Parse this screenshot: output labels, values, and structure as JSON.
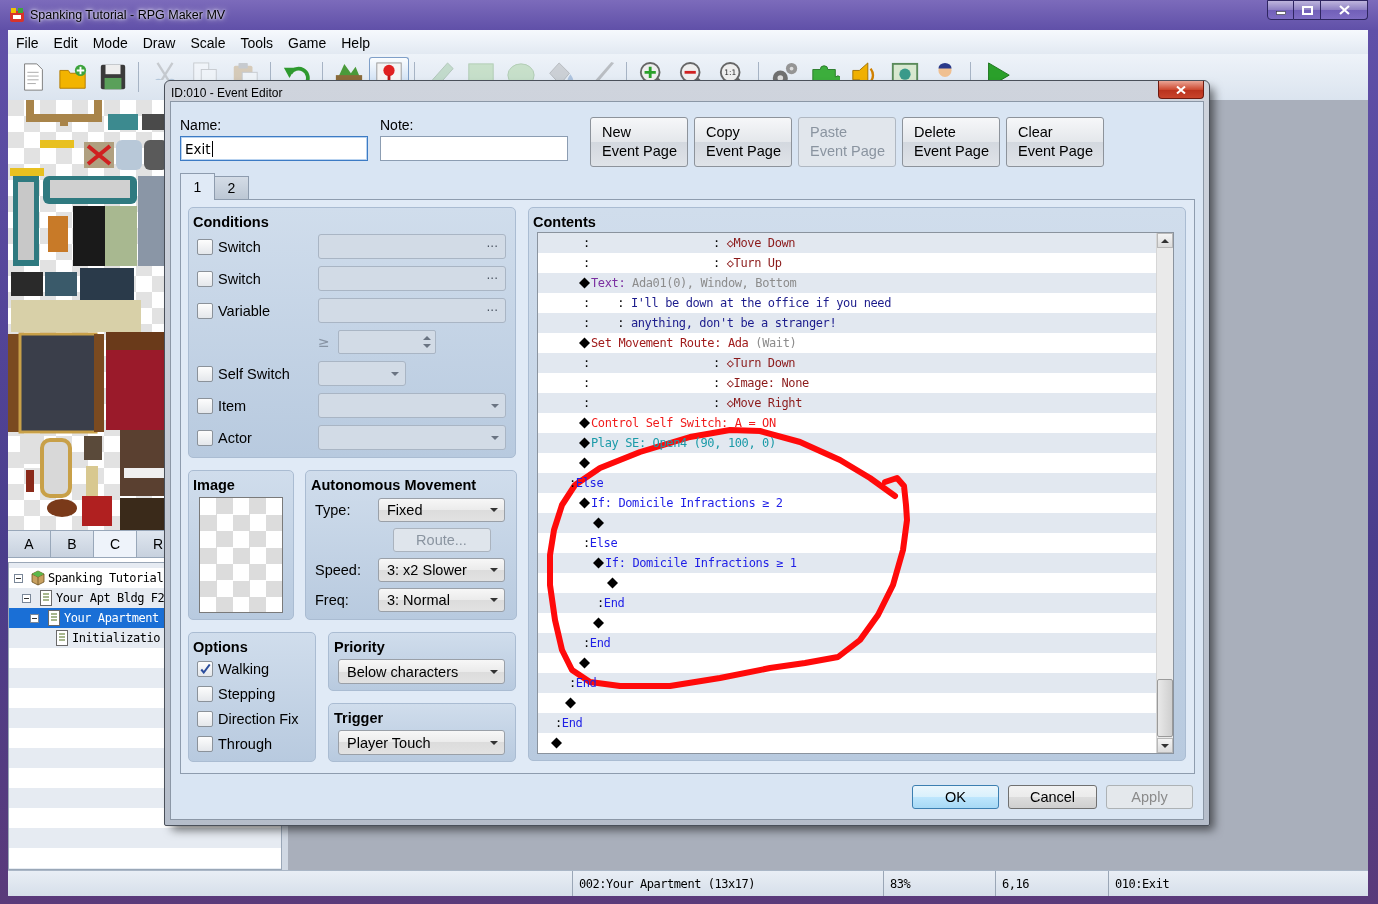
{
  "window": {
    "title": "Spanking Tutorial - RPG Maker MV"
  },
  "menu": [
    "File",
    "Edit",
    "Mode",
    "Draw",
    "Scale",
    "Tools",
    "Game",
    "Help"
  ],
  "toolbar": [
    {
      "buttons": [
        {
          "kind": "new",
          "disabled": false,
          "selected": false
        },
        {
          "kind": "open",
          "disabled": false,
          "selected": false
        },
        {
          "kind": "save",
          "disabled": false,
          "selected": false
        }
      ]
    },
    {
      "buttons": [
        {
          "kind": "cut",
          "disabled": true,
          "selected": false
        },
        {
          "kind": "copy",
          "disabled": true,
          "selected": false
        },
        {
          "kind": "paste",
          "disabled": true,
          "selected": false
        }
      ]
    },
    {
      "buttons": [
        {
          "kind": "undo",
          "disabled": false,
          "selected": false
        }
      ]
    },
    {
      "buttons": [
        {
          "kind": "map",
          "disabled": false,
          "selected": false
        },
        {
          "kind": "event",
          "disabled": false,
          "selected": true
        }
      ]
    },
    {
      "buttons": [
        {
          "kind": "pencil",
          "disabled": true,
          "selected": false
        },
        {
          "kind": "rectangle",
          "disabled": true,
          "selected": false
        },
        {
          "kind": "ellipse",
          "disabled": true,
          "selected": false
        },
        {
          "kind": "fill",
          "disabled": true,
          "selected": false
        },
        {
          "kind": "shadow",
          "disabled": true,
          "selected": false
        }
      ]
    },
    {
      "buttons": [
        {
          "kind": "zoom_in",
          "disabled": false,
          "selected": false
        },
        {
          "kind": "zoom_out",
          "disabled": false,
          "selected": false
        },
        {
          "kind": "zoom_reset",
          "label": "1:1",
          "disabled": false,
          "selected": false
        }
      ]
    },
    {
      "buttons": [
        {
          "kind": "database",
          "disabled": false,
          "selected": false
        },
        {
          "kind": "plugins",
          "disabled": false,
          "selected": false
        },
        {
          "kind": "sound",
          "disabled": false,
          "selected": false
        },
        {
          "kind": "generator",
          "disabled": false,
          "selected": false
        },
        {
          "kind": "resources",
          "disabled": false,
          "selected": false
        }
      ]
    },
    {
      "buttons": [
        {
          "kind": "playtest",
          "disabled": false,
          "selected": false
        }
      ]
    }
  ],
  "tileset_tabs": [
    {
      "label": "A",
      "selected": false
    },
    {
      "label": "B",
      "selected": false
    },
    {
      "label": "C",
      "selected": true
    },
    {
      "label": "R",
      "selected": false
    }
  ],
  "map_tree": [
    {
      "label": "Spanking Tutorial",
      "kind": "project",
      "expanded": true,
      "selected": false,
      "children": [
        {
          "label": "Your Apt Bldg F2",
          "kind": "map",
          "expanded": true,
          "selected": false,
          "children": [
            {
              "label": "Your Apartment",
              "kind": "map",
              "expanded": true,
              "selected": true,
              "children": [
                {
                  "label": "Initializatio",
                  "kind": "map",
                  "selected": false
                }
              ]
            }
          ]
        }
      ]
    }
  ],
  "status_bar": [
    "002:Your Apartment (13x17)",
    "83%",
    "6,16",
    "010:Exit"
  ],
  "dialog": {
    "title": "ID:010 - Event Editor",
    "name": {
      "label": "Name:",
      "value": "Exit",
      "focused": true
    },
    "note": {
      "label": "Note:",
      "focused": false
    },
    "page_buttons": [
      {
        "label": "New\nEvent Page",
        "disabled": false
      },
      {
        "label": "Copy\nEvent Page",
        "disabled": false
      },
      {
        "label": "Paste\nEvent Page",
        "disabled": true
      },
      {
        "label": "Delete\nEvent Page",
        "disabled": false
      },
      {
        "label": "Clear\nEvent Page",
        "disabled": false
      }
    ],
    "pages": [
      {
        "label": "1",
        "selected": true
      },
      {
        "label": "2",
        "selected": false
      }
    ],
    "conditions": {
      "title": "Conditions",
      "rows": [
        {
          "kind": "picker",
          "label": "Switch",
          "checked": false,
          "button": "···"
        },
        {
          "kind": "picker",
          "label": "Switch",
          "checked": false,
          "button": "···"
        },
        {
          "kind": "variable",
          "label": "Variable",
          "checked": false,
          "button": "···",
          "operator": "≥"
        },
        {
          "kind": "short_dropdown",
          "label": "Self Switch",
          "checked": false
        },
        {
          "kind": "dropdown",
          "label": "Item",
          "checked": false
        },
        {
          "kind": "dropdown",
          "label": "Actor",
          "checked": false
        }
      ]
    },
    "image": {
      "title": "Image"
    },
    "movement": {
      "title": "Autonomous Movement",
      "fields": [
        {
          "kind": "dropdown",
          "label": "Type:",
          "value": "Fixed"
        },
        {
          "kind": "button",
          "label": "Route...",
          "disabled": true
        },
        {
          "kind": "dropdown",
          "label": "Speed:",
          "value": "3: x2 Slower"
        },
        {
          "kind": "dropdown",
          "label": "Freq:",
          "value": "3: Normal"
        }
      ]
    },
    "options": {
      "title": "Options",
      "items": [
        {
          "label": "Walking",
          "checked": true
        },
        {
          "label": "Stepping",
          "checked": false
        },
        {
          "label": "Direction Fix",
          "checked": false
        },
        {
          "label": "Through",
          "checked": false
        }
      ]
    },
    "priority": {
      "title": "Priority",
      "value": "Below characters"
    },
    "trigger": {
      "title": "Trigger",
      "value": "Player Touch"
    },
    "contents": {
      "title": "Contents",
      "commands": [
        {
          "kind": "group",
          "children": [
            {
              "kind": "group",
              "children": [
                {
                  "kind": "line",
                  "parts": [
                    {
                      "text": ":                  : "
                    },
                    {
                      "text": "◇Move Down",
                      "color": "#8b1a1a"
                    }
                  ]
                },
                {
                  "kind": "line",
                  "parts": [
                    {
                      "text": ":                  : "
                    },
                    {
                      "text": "◇Turn Up",
                      "color": "#8b1a1a"
                    }
                  ]
                },
                {
                  "kind": "command",
                  "parts": [
                    {
                      "text": "Text: ",
                      "color": "#7a2fa0"
                    },
                    {
                      "text": "Ada01(0), Window, Bottom",
                      "color": "#8c8c8c"
                    }
                  ]
                },
                {
                  "kind": "line",
                  "parts": [
                    {
                      "text": ":    : "
                    },
                    {
                      "text": "I'll be down at the office if you need",
                      "color": "#1c1c8c"
                    }
                  ]
                },
                {
                  "kind": "line",
                  "parts": [
                    {
                      "text": ":    : "
                    },
                    {
                      "text": "anything, don't be a stranger!",
                      "color": "#1c1c8c"
                    }
                  ]
                },
                {
                  "kind": "command",
                  "parts": [
                    {
                      "text": "Set Movement Route: Ada ",
                      "color": "#a01c1c"
                    },
                    {
                      "text": "(Wait)",
                      "color": "#8c8c8c"
                    }
                  ]
                },
                {
                  "kind": "line",
                  "parts": [
                    {
                      "text": ":                  : "
                    },
                    {
                      "text": "◇Turn Down",
                      "color": "#8b1a1a"
                    }
                  ]
                },
                {
                  "kind": "line",
                  "parts": [
                    {
                      "text": ":                  : "
                    },
                    {
                      "text": "◇Image: None",
                      "color": "#8b1a1a"
                    }
                  ]
                },
                {
                  "kind": "line",
                  "parts": [
                    {
                      "text": ":                  : "
                    },
                    {
                      "text": "◇Move Right",
                      "color": "#8b1a1a"
                    }
                  ]
                },
                {
                  "kind": "command",
                  "parts": [
                    {
                      "text": "Control Self Switch: A = ON",
                      "color": "#f01c1c"
                    }
                  ]
                },
                {
                  "kind": "command",
                  "parts": [
                    {
                      "text": "Play SE: Open4 (90, 100, 0)",
                      "color": "#1a9aa8"
                    }
                  ]
                },
                {
                  "kind": "command"
                }
              ]
            },
            {
              "kind": "line",
              "parts": [
                {
                  "text": ":"
                },
                {
                  "text": "Else",
                  "color": "#1e1ee6"
                }
              ],
              "children": [
                {
                  "kind": "command",
                  "parts": [
                    {
                      "text": "If: Domicile Infractions ≥ 2",
                      "color": "#1e1ee6"
                    }
                  ],
                  "children": [
                    {
                      "kind": "command"
                    }
                  ]
                },
                {
                  "kind": "line",
                  "parts": [
                    {
                      "text": ":"
                    },
                    {
                      "text": "Else",
                      "color": "#1e1ee6"
                    }
                  ],
                  "children": [
                    {
                      "kind": "command",
                      "parts": [
                        {
                          "text": "If: Domicile Infractions ≥ 1",
                          "color": "#1e1ee6"
                        }
                      ],
                      "children": [
                        {
                          "kind": "command"
                        }
                      ]
                    },
                    {
                      "kind": "line",
                      "parts": [
                        {
                          "text": ":"
                        },
                        {
                          "text": "End",
                          "color": "#1e1ee6"
                        }
                      ]
                    },
                    {
                      "kind": "command"
                    }
                  ]
                },
                {
                  "kind": "line",
                  "parts": [
                    {
                      "text": ":"
                    },
                    {
                      "text": "End",
                      "color": "#1e1ee6"
                    }
                  ]
                },
                {
                  "kind": "command"
                }
              ]
            },
            {
              "kind": "line",
              "parts": [
                {
                  "text": ":"
                },
                {
                  "text": "End",
                  "color": "#1e1ee6"
                }
              ]
            },
            {
              "kind": "command"
            }
          ]
        },
        {
          "kind": "line",
          "parts": [
            {
              "text": ":"
            },
            {
              "text": "End",
              "color": "#1e1ee6"
            }
          ]
        },
        {
          "kind": "command"
        }
      ]
    },
    "buttons": [
      {
        "label": "OK",
        "default": true,
        "disabled": false
      },
      {
        "label": "Cancel",
        "default": false,
        "disabled": false
      },
      {
        "label": "Apply",
        "default": false,
        "disabled": true
      }
    ]
  }
}
